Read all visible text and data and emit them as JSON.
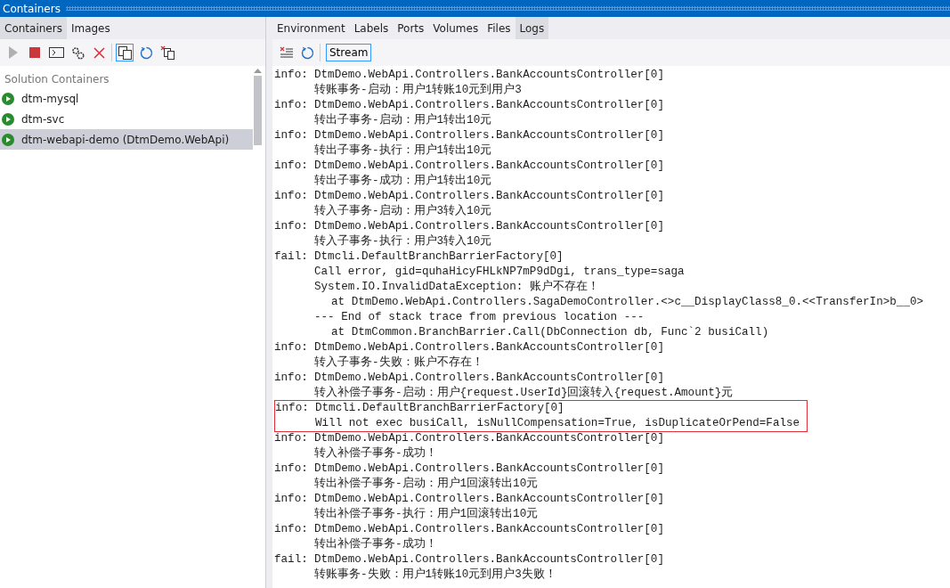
{
  "window": {
    "title": "Containers"
  },
  "left_tabs": [
    {
      "label": "Containers",
      "selected": true
    },
    {
      "label": "Images",
      "selected": false
    }
  ],
  "left_toolbar": [
    {
      "kind": "start",
      "disabled": true
    },
    {
      "kind": "stop",
      "disabled": false
    },
    {
      "kind": "terminal",
      "disabled": false
    },
    {
      "kind": "settings",
      "disabled": false
    },
    {
      "kind": "delete",
      "disabled": false
    },
    {
      "kind": "separator"
    },
    {
      "kind": "copy",
      "selected": true
    },
    {
      "kind": "refresh",
      "disabled": false
    },
    {
      "kind": "prune",
      "disabled": false
    }
  ],
  "sidebar": {
    "group": "Solution Containers",
    "items": [
      {
        "label": "dtm-mysql",
        "selected": false,
        "running": true
      },
      {
        "label": "dtm-svc",
        "selected": false,
        "running": true
      },
      {
        "label": "dtm-webapi-demo (DtmDemo.WebApi)",
        "selected": true,
        "running": true
      }
    ]
  },
  "detail_tabs": [
    {
      "label": "Environment",
      "selected": false
    },
    {
      "label": "Labels",
      "selected": false
    },
    {
      "label": "Ports",
      "selected": false
    },
    {
      "label": "Volumes",
      "selected": false
    },
    {
      "label": "Files",
      "selected": false
    },
    {
      "label": "Logs",
      "selected": true
    }
  ],
  "log_toolbar": {
    "stream_label": "Stream",
    "stream_on": true
  },
  "log": [
    {
      "level": "info:",
      "source": "DtmDemo.WebApi.Controllers.BankAccountsController[0]",
      "highlighted": false,
      "lines": [
        {
          "kind": "message",
          "text": "转账事务-启动：用户1转账10元到用户3"
        }
      ]
    },
    {
      "level": "info:",
      "source": "DtmDemo.WebApi.Controllers.BankAccountsController[0]",
      "highlighted": false,
      "lines": [
        {
          "kind": "message",
          "text": "转出子事务-启动：用户1转出10元"
        }
      ]
    },
    {
      "level": "info:",
      "source": "DtmDemo.WebApi.Controllers.BankAccountsController[0]",
      "highlighted": false,
      "lines": [
        {
          "kind": "message",
          "text": "转出子事务-执行：用户1转出10元"
        }
      ]
    },
    {
      "level": "info:",
      "source": "DtmDemo.WebApi.Controllers.BankAccountsController[0]",
      "highlighted": false,
      "lines": [
        {
          "kind": "message",
          "text": "转出子事务-成功：用户1转出10元"
        }
      ]
    },
    {
      "level": "info:",
      "source": "DtmDemo.WebApi.Controllers.BankAccountsController[0]",
      "highlighted": false,
      "lines": [
        {
          "kind": "message",
          "text": "转入子事务-启动：用户3转入10元"
        }
      ]
    },
    {
      "level": "info:",
      "source": "DtmDemo.WebApi.Controllers.BankAccountsController[0]",
      "highlighted": false,
      "lines": [
        {
          "kind": "message",
          "text": "转入子事务-执行：用户3转入10元"
        }
      ]
    },
    {
      "level": "fail:",
      "source": "Dtmcli.DefaultBranchBarrierFactory[0]",
      "highlighted": false,
      "lines": [
        {
          "kind": "message",
          "text": "Call error, gid=quhaHicyFHLkNP7mP9dDgi, trans_type=saga"
        },
        {
          "kind": "message",
          "text": "System.IO.InvalidDataException: 账户不存在！"
        },
        {
          "kind": "stack",
          "text": "at DtmDemo.WebApi.Controllers.SagaDemoController.<>c__DisplayClass8_0.<<TransferIn>b__0>"
        },
        {
          "kind": "message",
          "text": "--- End of stack trace from previous location ---"
        },
        {
          "kind": "stack",
          "text": "at DtmCommon.BranchBarrier.Call(DbConnection db, Func`2 busiCall)"
        }
      ]
    },
    {
      "level": "info:",
      "source": "DtmDemo.WebApi.Controllers.BankAccountsController[0]",
      "highlighted": false,
      "lines": [
        {
          "kind": "message",
          "text": "转入子事务-失败：账户不存在！"
        }
      ]
    },
    {
      "level": "info:",
      "source": "DtmDemo.WebApi.Controllers.BankAccountsController[0]",
      "highlighted": false,
      "lines": [
        {
          "kind": "message",
          "text": "转入补偿子事务-启动：用户{request.UserId}回滚转入{request.Amount}元"
        }
      ]
    },
    {
      "level": "info:",
      "source": "Dtmcli.DefaultBranchBarrierFactory[0]",
      "highlighted": true,
      "lines": [
        {
          "kind": "message",
          "text": "Will not exec busiCall, isNullCompensation=True, isDuplicateOrPend=False"
        }
      ]
    },
    {
      "level": "info:",
      "source": "DtmDemo.WebApi.Controllers.BankAccountsController[0]",
      "highlighted": false,
      "lines": [
        {
          "kind": "message",
          "text": "转入补偿子事务-成功！"
        }
      ]
    },
    {
      "level": "info:",
      "source": "DtmDemo.WebApi.Controllers.BankAccountsController[0]",
      "highlighted": false,
      "lines": [
        {
          "kind": "message",
          "text": "转出补偿子事务-启动：用户1回滚转出10元"
        }
      ]
    },
    {
      "level": "info:",
      "source": "DtmDemo.WebApi.Controllers.BankAccountsController[0]",
      "highlighted": false,
      "lines": [
        {
          "kind": "message",
          "text": "转出补偿子事务-执行：用户1回滚转出10元"
        }
      ]
    },
    {
      "level": "info:",
      "source": "DtmDemo.WebApi.Controllers.BankAccountsController[0]",
      "highlighted": false,
      "lines": [
        {
          "kind": "message",
          "text": "转出补偿子事务-成功！"
        }
      ]
    },
    {
      "level": "fail:",
      "source": "DtmDemo.WebApi.Controllers.BankAccountsController[0]",
      "highlighted": false,
      "lines": [
        {
          "kind": "message",
          "text": "转账事务-失败：用户1转账10元到用户3失败！"
        }
      ]
    }
  ]
}
